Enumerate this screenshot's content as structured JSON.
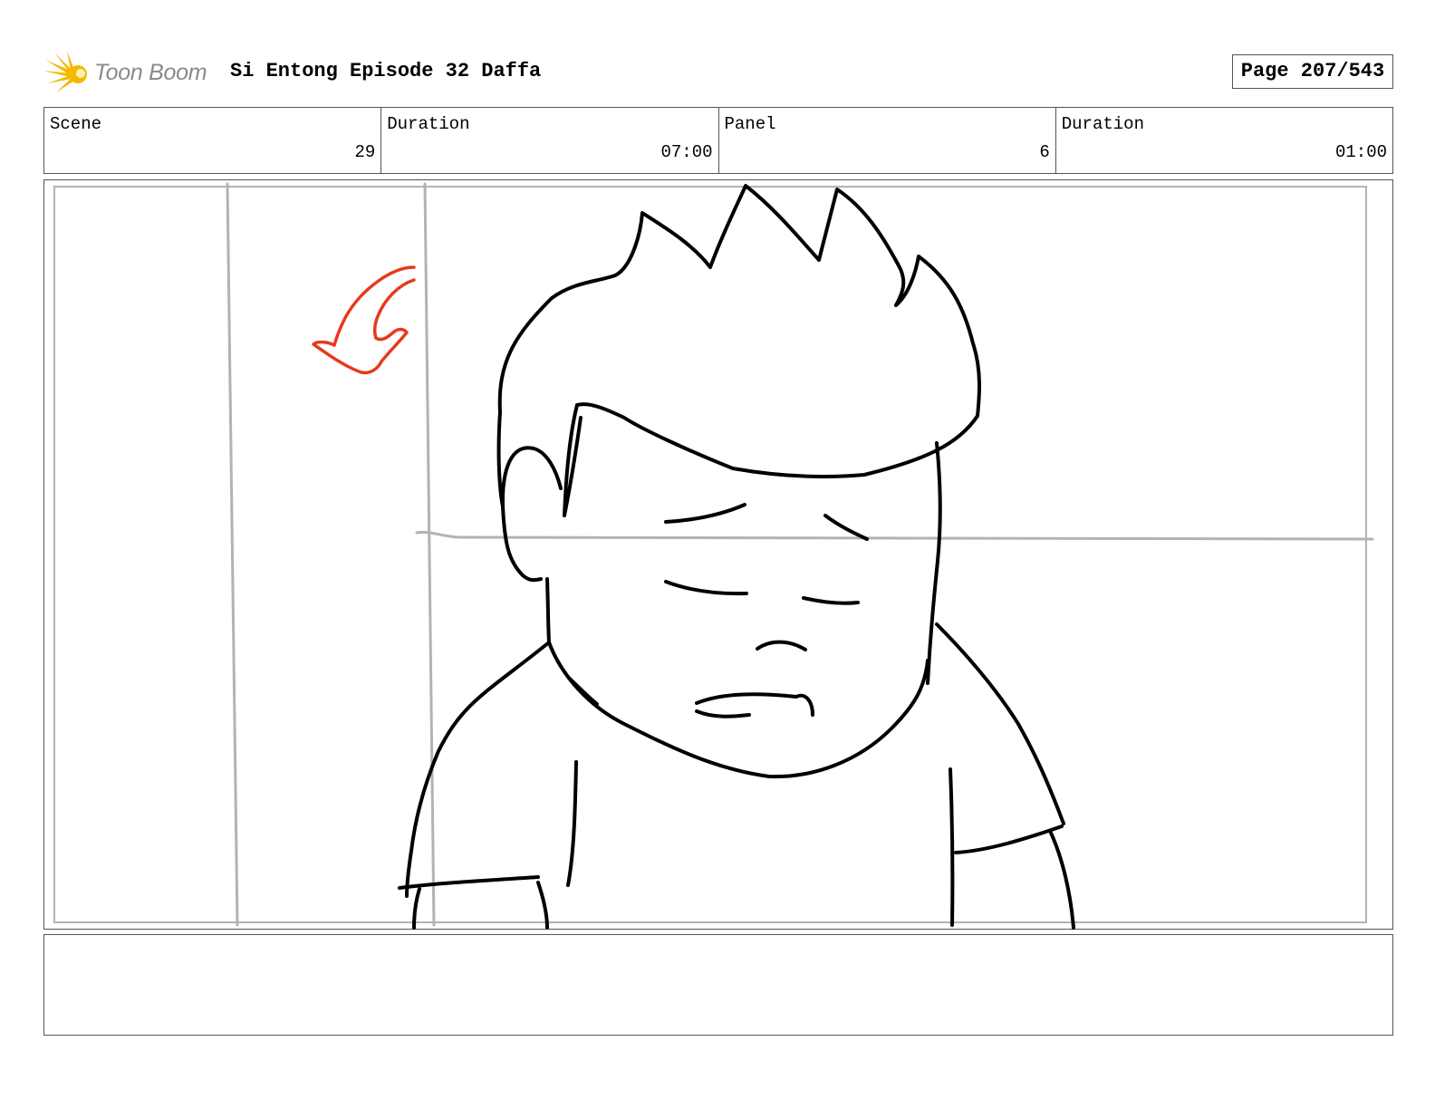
{
  "header": {
    "logo_text": "Toon Boom",
    "logo_icon": "starburst-logo-icon",
    "project_title": "Si Entong Episode 32 Daffa",
    "page_label": "Page 207/543"
  },
  "info": {
    "scene_label": "Scene",
    "scene_value": "29",
    "scene_duration_label": "Duration",
    "scene_duration_value": "07:00",
    "panel_label": "Panel",
    "panel_value": "6",
    "panel_duration_label": "Duration",
    "panel_duration_value": "01:00"
  },
  "panel": {
    "image": "storyboard-sketch: boy with spiky hair, eyes closed, looking down; red curved arrow at upper left",
    "arrow_color": "#e8391c"
  },
  "notes": {
    "text": ""
  },
  "colors": {
    "line": "#555555",
    "guide": "#b3b3b3",
    "logo_yellow": "#f5b800",
    "logo_text": "#8a8a8a"
  }
}
